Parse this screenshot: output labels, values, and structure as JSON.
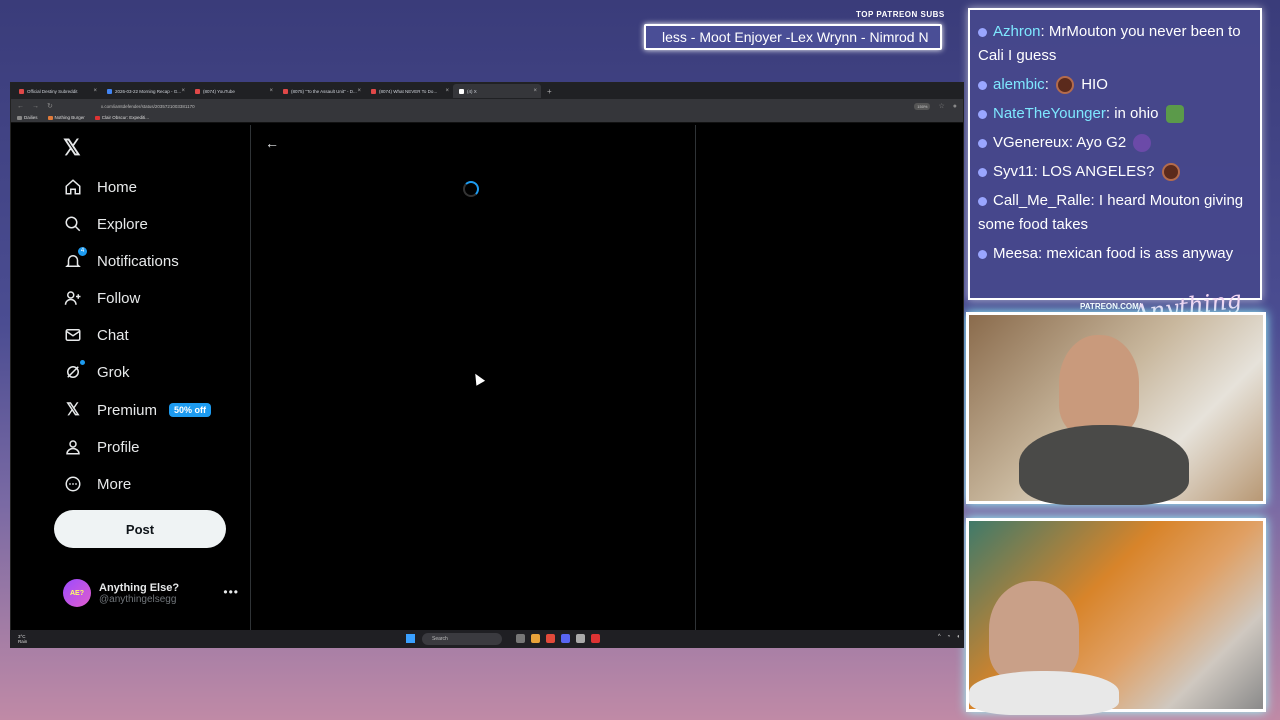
{
  "overlay": {
    "patreon_subs_title": "TOP PATREON SUBS",
    "patreon_ticker": "less - Moot Enjoyer -Lex Wrynn - Nimrod N",
    "patreon_url": "PATREON.COM/",
    "brand_logo": "Anything Else?",
    "chat": [
      {
        "user": "Azhron",
        "user_color": "#7ee8ff",
        "text": "MrMouton you never been to Cali I guess"
      },
      {
        "user": "alembic",
        "user_color": "#7ee8ff",
        "text": "HIO",
        "emote_before": "brown"
      },
      {
        "user": "NateTheYounger",
        "user_color": "#7ee8ff",
        "text": "in ohio",
        "emote_after": "green"
      },
      {
        "user": "VGenereux",
        "user_color": "#ffffff",
        "text": "Ayo G2",
        "emote_after": "purple"
      },
      {
        "user": "Syv11",
        "user_color": "#ffffff",
        "text": "LOS ANGELES?",
        "emote_after": "brown"
      },
      {
        "user": "Call_Me_Ralle",
        "user_color": "#ffffff",
        "text": "I heard Mouton giving some food takes",
        "emote_mid": "green"
      },
      {
        "user": "Meesa",
        "user_color": "#ffffff",
        "text": "mexican food is ass anyway"
      }
    ]
  },
  "browser": {
    "tabs": [
      {
        "title": "Official Destiny Subreddit"
      },
      {
        "title": "2026-03-22 Morning Recap - G..."
      },
      {
        "title": "(8074) YouTube"
      },
      {
        "title": "(8075) \"To the Assault Unit\" - D..."
      },
      {
        "title": "(8074) What NEVER To Do..."
      },
      {
        "title": "(4) X",
        "active": true
      }
    ],
    "url": "x.com/iamtdefender/status/2035721003381170",
    "zoom": "150%",
    "bookmarks": [
      "Dailies",
      "Nothing Burger",
      "Clair Obscur: Expediti..."
    ]
  },
  "x": {
    "nav": [
      {
        "key": "home",
        "label": "Home",
        "icon": "home-icon"
      },
      {
        "key": "explore",
        "label": "Explore",
        "icon": "search-icon"
      },
      {
        "key": "notifications",
        "label": "Notifications",
        "icon": "bell-icon",
        "count": "4"
      },
      {
        "key": "follow",
        "label": "Follow",
        "icon": "add-person-icon"
      },
      {
        "key": "chat",
        "label": "Chat",
        "icon": "mail-icon"
      },
      {
        "key": "grok",
        "label": "Grok",
        "icon": "grok-icon"
      },
      {
        "key": "premium",
        "label": "Premium",
        "icon": "x-icon",
        "badge": "50% off"
      },
      {
        "key": "profile",
        "label": "Profile",
        "icon": "person-icon"
      },
      {
        "key": "more",
        "label": "More",
        "icon": "more-circle-icon"
      }
    ],
    "post_label": "Post",
    "account": {
      "name": "Anything Else?",
      "handle": "@anythingelsegg",
      "avatar_text": "AE?"
    }
  },
  "taskbar": {
    "weather_temp": "3°C",
    "weather_text": "Rain",
    "search_placeholder": "Search"
  }
}
